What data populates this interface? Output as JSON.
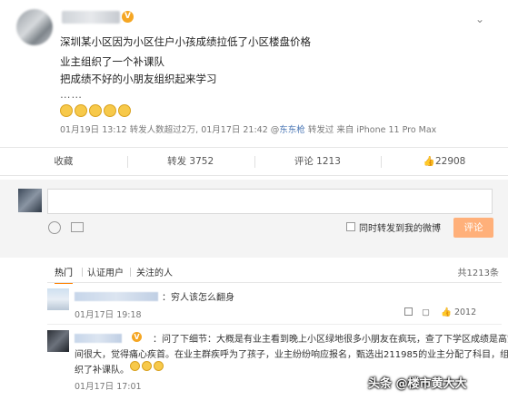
{
  "post": {
    "lines": [
      "深圳某小区因为小区住户小孩成绩拉低了小区楼盘价格",
      "业主组织了一个补课队",
      "把成绩不好的小朋友组织起来学习",
      "……"
    ],
    "meta_date": "01月19日 13:12 转发人数超过2万",
    "meta_date2": "01月17日 21:42 @",
    "meta_handle": "东东枪",
    "meta_tail": " 转发过  来自 iPhone 11 Pro Max",
    "menu_icon": "chevron-down-icon",
    "badge": "V"
  },
  "actions": {
    "fav": "收藏",
    "repost": "转发 3752",
    "comment": "评论 1213",
    "like": "22908"
  },
  "compose": {
    "also_repost": "同时转发到我的微博",
    "submit": "评论"
  },
  "tabs": {
    "hot": "热门",
    "verified": "认证用户",
    "followed": "关注的人",
    "total": "共1213条"
  },
  "comments": [
    {
      "text": "：穷人该怎么翻身",
      "time": "01月17日 19:18"
    },
    {
      "line1": "：问了下细节：大概是有业主看到晚上小区绿地很多小朋友在疯玩，查了下学区成绩是高空",
      "line2": "间很大，觉得痛心疾首。在业主群疾呼为了孩子，业主纷纷响应报名，甄选出211985的业主分配了科目，组",
      "line3": "织了补课队。",
      "time": "01月17日 17:01",
      "likes": "2012",
      "badge": "V"
    }
  ],
  "watermark": "头条 @楼市黄大大"
}
